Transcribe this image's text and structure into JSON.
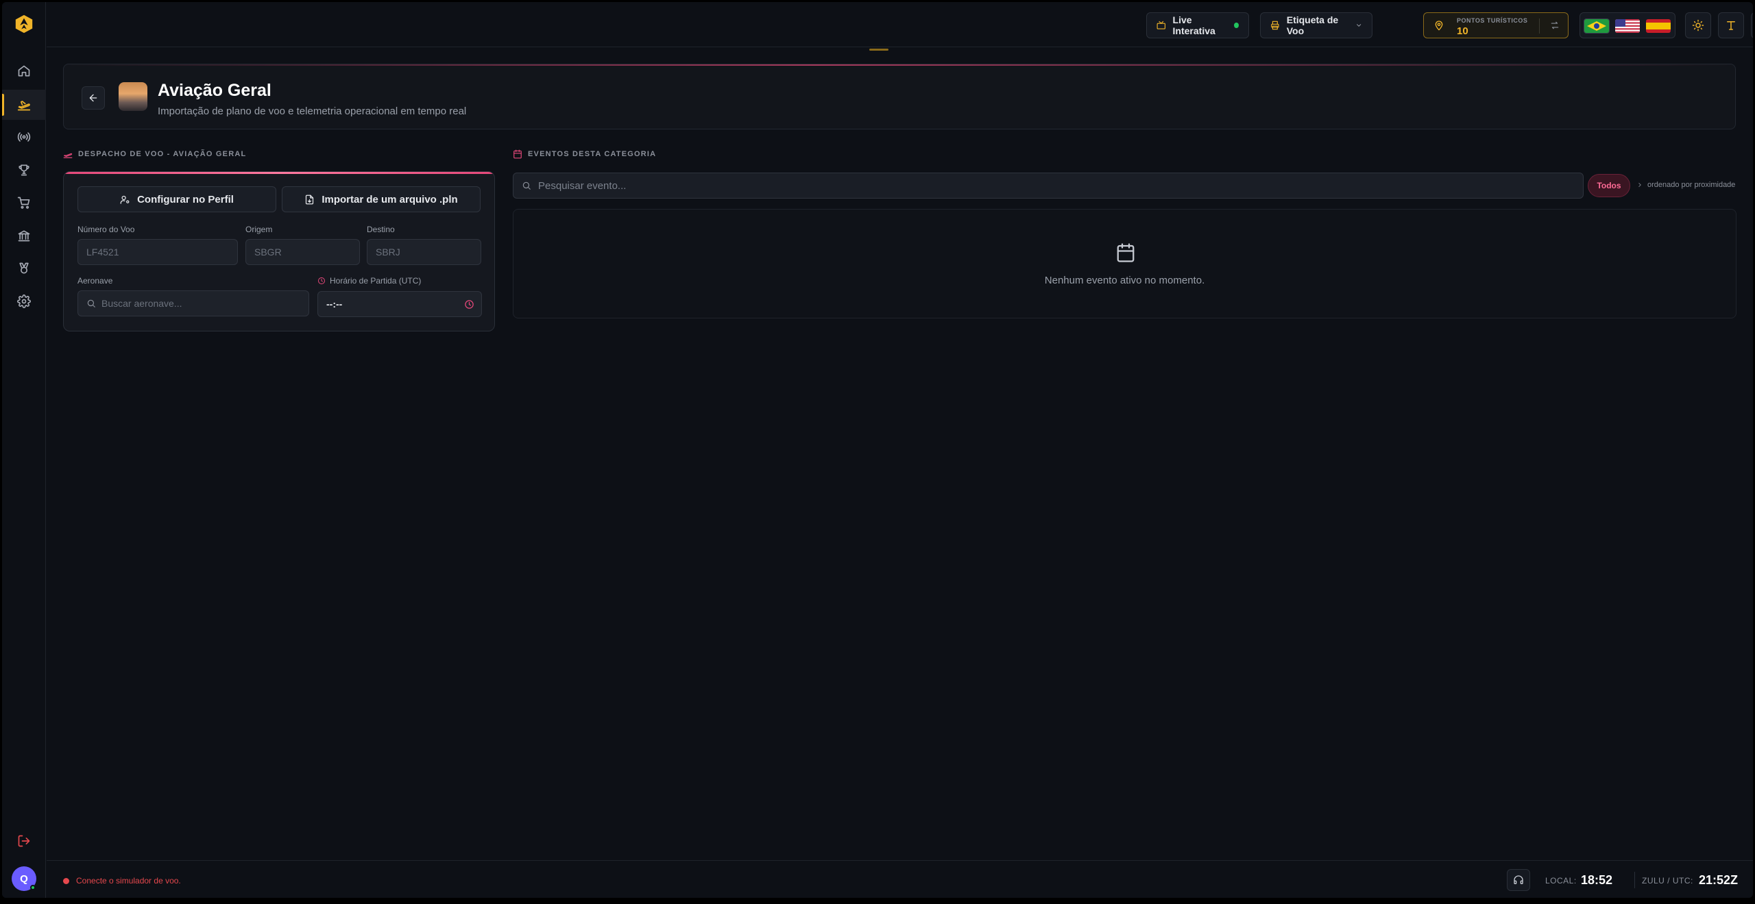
{
  "sidebar": {
    "items": [
      {
        "name": "home",
        "icon": "home-icon"
      },
      {
        "name": "flight",
        "icon": "plane-takeoff-icon",
        "active": true
      },
      {
        "name": "live",
        "icon": "broadcast-icon"
      },
      {
        "name": "trophy",
        "icon": "trophy-icon"
      },
      {
        "name": "shop",
        "icon": "cart-icon"
      },
      {
        "name": "bank",
        "icon": "bank-icon"
      },
      {
        "name": "badges",
        "icon": "medal-icon"
      },
      {
        "name": "settings",
        "icon": "gear-icon"
      }
    ],
    "avatar_initial": "Q"
  },
  "topbar": {
    "live_label": "Live Interativa",
    "tag_label": "Etiqueta de Voo",
    "points_label": "PONTOS TURÍSTICOS",
    "points_value": "10"
  },
  "header": {
    "title": "Aviação Geral",
    "subtitle": "Importação de plano de voo e telemetria operacional em tempo real"
  },
  "dispatch": {
    "section_label": "DESPACHO DE VOO - AVIAÇÃO GERAL",
    "profile_button": "Configurar no Perfil",
    "import_button": "Importar de um arquivo .pln",
    "flight_number_label": "Número do Voo",
    "flight_number_placeholder": "LF4521",
    "origin_label": "Origem",
    "origin_placeholder": "SBGR",
    "destination_label": "Destino",
    "destination_placeholder": "SBRJ",
    "aircraft_label": "Aeronave",
    "aircraft_placeholder": "Buscar aeronave...",
    "departure_label": "Horário de Partida (UTC)",
    "departure_value": "--:--"
  },
  "events": {
    "section_label": "EVENTOS DESTA CATEGORIA",
    "search_placeholder": "Pesquisar evento...",
    "filter_label": "Todos",
    "sort_label": "ordenado por proximidade",
    "empty_message": "Nenhum evento ativo no momento."
  },
  "footer": {
    "sim_status": "Conecte o simulador de voo.",
    "local_label": "LOCAL:",
    "local_time": "18:52",
    "zulu_label": "ZULU / UTC:",
    "zulu_time": "21:52Z"
  },
  "colors": {
    "accent_gold": "#f0b429",
    "accent_pink": "#e5487a",
    "status_red": "#e5484d",
    "status_green": "#22c55e"
  }
}
